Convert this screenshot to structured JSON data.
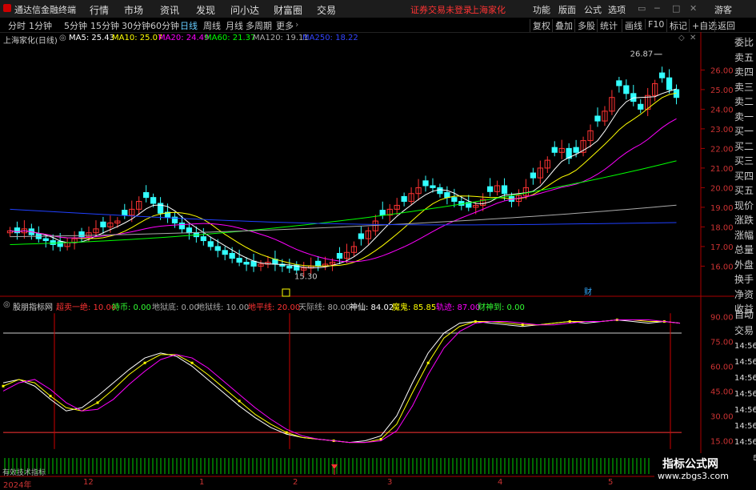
{
  "window": {
    "app_title": "通达信金融终端",
    "status": "证券交易未登录",
    "stock": "上海家化",
    "user": "游客"
  },
  "menu": [
    "行情",
    "市场",
    "资讯",
    "发现",
    "问小达",
    "财富圈",
    "交易"
  ],
  "top_menu": [
    "功能",
    "版面",
    "公式",
    "选项"
  ],
  "periods": [
    "分时",
    "1分钟",
    "5分钟",
    "15分钟",
    "30分钟",
    "60分钟",
    "日线",
    "周线",
    "月线",
    "多周期",
    "更多"
  ],
  "active_period": "日线",
  "tools": [
    "复权",
    "叠加",
    "多股",
    "统计",
    "画线",
    "F10",
    "标记",
    "+自选",
    "返回"
  ],
  "right_sidebar": [
    "委比",
    "卖五",
    "卖四",
    "卖三",
    "卖二",
    "卖一",
    "买一",
    "买二",
    "买三",
    "买四",
    "买五",
    "现价",
    "涨跌",
    "涨幅",
    "总量",
    "外盘",
    "换手",
    "净资",
    "收益"
  ],
  "right_sidebar_low": [
    "自动",
    "交易",
    "14:56",
    "14:56",
    "14:56",
    "14:56",
    "14:56",
    "14:56",
    "14:56",
    "14:56"
  ],
  "main_legend": {
    "name": "上海家化(日线)",
    "ma5": "MA5: 25.43",
    "ma10": "MA10: 25.07",
    "ma20": "MA20: 24.49",
    "ma60": "MA60: 21.37",
    "ma120": "MA120: 19.11",
    "ma250": "MA250: 18.22"
  },
  "ind_legend": {
    "name": "股朋指标网",
    "a": "超卖一绝: 10.00",
    "b": "持币: 0.00",
    "c": "地狱底: 0.00",
    "d": "地狱线: 10.00",
    "e": "地平线: 20.00",
    "f": "天际线: 80.00",
    "g": "神仙: 84.02",
    "h": "魔鬼: 85.85",
    "i": "轨迹: 87.00",
    "j": "财神到: 0.00"
  },
  "annotations": {
    "high": "26.87",
    "low": "15.30",
    "cai": "财",
    "bottom_text": "有效技术指标"
  },
  "watermark": {
    "line1": "指标公式网",
    "line2": "www.zbgs3.com"
  },
  "colors": {
    "up": "#ff3333",
    "down": "#33ffff",
    "ma5": "#ffffff",
    "ma10": "#ffff00",
    "ma20": "#ff00ff",
    "ma60": "#00ff00",
    "ma120": "#aaaaaa",
    "ma250": "#2040ff"
  },
  "chart_data": [
    {
      "type": "candlestick",
      "title": "上海家化(日线)",
      "y_ticks": [
        16.0,
        17.0,
        18.0,
        19.0,
        20.0,
        21.0,
        22.0,
        23.0,
        24.0,
        25.0,
        26.0
      ],
      "ylim": [
        15.2,
        27.2
      ],
      "x_labels": [
        "2024年",
        "12",
        "1",
        "2",
        "3",
        "4",
        "5"
      ],
      "ohlc_close": [
        17.8,
        17.7,
        17.9,
        17.6,
        17.4,
        17.3,
        17.1,
        17.0,
        17.2,
        17.4,
        17.5,
        17.7,
        17.9,
        18.0,
        18.2,
        18.3,
        18.6,
        18.9,
        19.3,
        19.5,
        19.2,
        18.7,
        18.5,
        18.2,
        17.9,
        17.7,
        17.5,
        17.3,
        17.0,
        16.8,
        16.6,
        16.4,
        16.2,
        16.1,
        16.0,
        16.1,
        16.2,
        16.1,
        16.0,
        15.9,
        15.8,
        15.9,
        16.0,
        16.0,
        16.1,
        16.2,
        16.4,
        16.7,
        17.0,
        17.4,
        17.8,
        18.3,
        18.6,
        18.9,
        19.1,
        19.3,
        19.7,
        20.0,
        20.1,
        20.0,
        19.7,
        19.5,
        19.3,
        19.1,
        19.0,
        19.1,
        19.4,
        19.8,
        20.1,
        19.7,
        19.3,
        19.6,
        20.0,
        20.5,
        21.0,
        21.4,
        21.8,
        22.0,
        21.5,
        21.8,
        22.4,
        22.9,
        23.4,
        23.9,
        24.6,
        25.2,
        24.8,
        24.4,
        24.0,
        24.7,
        25.3,
        25.6,
        25.0,
        24.6
      ],
      "series": [
        {
          "name": "MA5",
          "values": [
            25.43
          ]
        },
        {
          "name": "MA10",
          "values": [
            25.07
          ]
        },
        {
          "name": "MA20",
          "values": [
            24.49
          ]
        },
        {
          "name": "MA60",
          "values": [
            21.37
          ]
        },
        {
          "name": "MA120",
          "values": [
            19.11
          ]
        },
        {
          "name": "MA250",
          "values": [
            18.22
          ]
        }
      ]
    },
    {
      "type": "line",
      "title": "股朋指标网",
      "y_ticks": [
        15.0,
        30.0,
        45.0,
        60.0,
        75.0,
        90.0
      ],
      "ylim": [
        8,
        95
      ],
      "series": [
        {
          "name": "神仙",
          "values": [
            50,
            52,
            48,
            40,
            33,
            35,
            42,
            50,
            58,
            65,
            68,
            66,
            60,
            52,
            44,
            36,
            29,
            23,
            19,
            17,
            16,
            15,
            14,
            15,
            18,
            30,
            50,
            68,
            80,
            86,
            87,
            86,
            85,
            84,
            85,
            86,
            87,
            86,
            87,
            88,
            87,
            86,
            87,
            86
          ]
        },
        {
          "name": "魔鬼",
          "values": [
            48,
            52,
            50,
            42,
            35,
            33,
            38,
            46,
            55,
            62,
            67,
            67,
            62,
            55,
            47,
            39,
            31,
            25,
            20,
            17,
            16,
            15,
            14,
            14,
            16,
            25,
            44,
            62,
            77,
            84,
            87,
            87,
            86,
            85,
            85,
            86,
            87,
            87,
            87,
            88,
            88,
            87,
            87,
            86
          ]
        },
        {
          "name": "轨迹",
          "values": [
            45,
            50,
            52,
            46,
            38,
            33,
            34,
            40,
            49,
            57,
            64,
            67,
            65,
            59,
            51,
            43,
            35,
            28,
            22,
            18,
            16,
            15,
            14,
            14,
            15,
            21,
            36,
            55,
            71,
            81,
            86,
            87,
            87,
            86,
            85,
            85,
            86,
            87,
            87,
            88,
            88,
            88,
            87,
            86
          ]
        }
      ]
    }
  ]
}
